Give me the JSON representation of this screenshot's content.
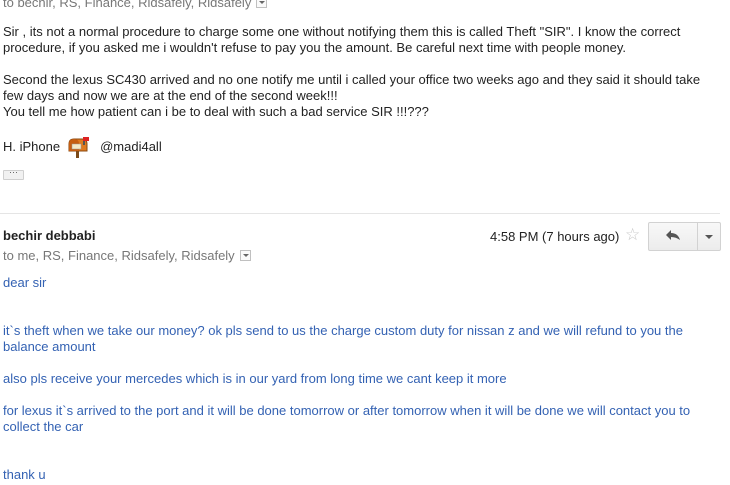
{
  "message1": {
    "recipients": "to bechir, RS, Finance, Ridsafely, Ridsafely",
    "paragraphs": [
      "Sir , its not a normal procedure to charge some one without notifying them this is called  Theft \"SIR\".  I know the correct procedure, if you asked me i wouldn't refuse to pay you the amount. Be careful next time with people money.",
      "Second the lexus SC430 arrived and no one notify me until i called your office two weeks ago and they said it should take few days and now we are at the end of the second week!!!",
      "You tell me how patient can i be to deal with such a bad service SIR !!!???"
    ],
    "signature_prefix": "H. iPhone",
    "signature_handle": "@madi4all",
    "ellipsis": "···"
  },
  "message2": {
    "sender": "bechir debbabi",
    "time": "4:58 PM (7 hours ago)",
    "recipients": "to me, RS, Finance, Ridsafely, Ridsafely",
    "lines": [
      "dear sir",
      "it`s theft when we take our money? ok pls send to us the charge custom duty for nissan z and we will refund to you the balance amount",
      "also pls receive your mercedes which is in our yard from long time we cant keep it more",
      "for lexus it`s arrived to the port and  it will be done tomorrow or after tomorrow when it will be done we will contact you to collect the car",
      "thank u"
    ]
  },
  "icons": {
    "star": "star-icon",
    "reply": "reply-icon",
    "more": "dropdown-arrow-icon",
    "mailbox": "mailbox-icon"
  },
  "colors": {
    "quoted_text": "#3462b3",
    "meta_text": "#777777"
  }
}
